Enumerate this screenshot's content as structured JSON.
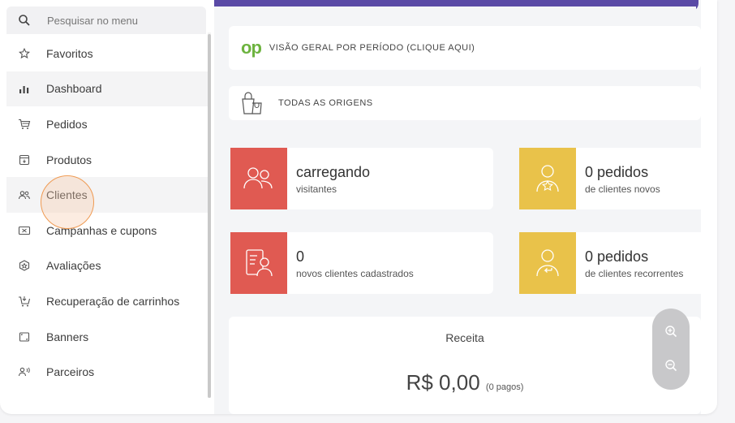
{
  "search": {
    "placeholder": "Pesquisar no menu"
  },
  "menu": [
    {
      "label": "Favoritos",
      "icon": "star-icon"
    },
    {
      "label": "Dashboard",
      "icon": "bar-chart-icon"
    },
    {
      "label": "Pedidos",
      "icon": "cart-icon"
    },
    {
      "label": "Produtos",
      "icon": "box-icon"
    },
    {
      "label": "Clientes",
      "icon": "users-icon"
    },
    {
      "label": "Campanhas e cupons",
      "icon": "ticket-icon"
    },
    {
      "label": "Avaliações",
      "icon": "rating-icon"
    },
    {
      "label": "Recuperação de carrinhos",
      "icon": "cart-recover-icon"
    },
    {
      "label": "Banners",
      "icon": "banner-icon"
    },
    {
      "label": "Parceiros",
      "icon": "partner-icon"
    }
  ],
  "main": {
    "period_label": "Visão geral por período (clique aqui)",
    "logo_text": "op",
    "origins_label": "Todas as origens",
    "stats": [
      {
        "big": "carregando",
        "small": "visitantes",
        "color": "#e05a52"
      },
      {
        "big": "0 pedidos",
        "small": "de clientes novos",
        "color": "#e9c24a"
      },
      {
        "big": "0",
        "small": "novos clientes cadastrados",
        "color": "#e05a52"
      },
      {
        "big": "0 pedidos",
        "small": "de clientes recorrentes",
        "color": "#e9c24a"
      }
    ],
    "revenue": {
      "title": "Receita",
      "value": "R$ 0,00",
      "paid": "(0 pagos)"
    }
  },
  "colors": {
    "accent": "#5a4aa6",
    "red": "#e05a52",
    "yellow": "#e9c24a",
    "brand_green": "#6db33f"
  }
}
